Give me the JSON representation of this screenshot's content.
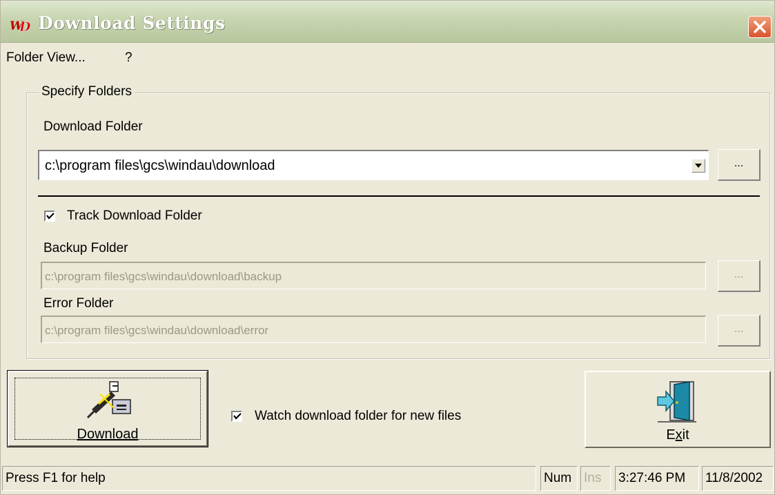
{
  "window": {
    "title": "Download Settings",
    "logo_text": "WD"
  },
  "menu": {
    "items": [
      "Folder View...",
      "?"
    ]
  },
  "group": {
    "legend": "Specify Folders",
    "download_folder_label": "Download Folder",
    "download_folder_value": "c:\\program files\\gcs\\windau\\download",
    "browse_label": "...",
    "track_label": "Track Download Folder",
    "track_checked": true,
    "backup_label": "Backup Folder",
    "backup_value": "c:\\program files\\gcs\\windau\\download\\backup",
    "error_label": "Error Folder",
    "error_value": "c:\\program files\\gcs\\windau\\download\\error"
  },
  "actions": {
    "download_label": "Download",
    "watch_label": "Watch download folder for new files",
    "watch_checked": true,
    "exit_label": "Exit"
  },
  "status": {
    "help": "Press F1 for help",
    "num": "Num",
    "ins": "Ins",
    "time": "3:27:46 PM",
    "date": "11/8/2002"
  },
  "colors": {
    "face": "#ece9d8",
    "close": "#d9542d",
    "title_text": "#ffffff"
  }
}
